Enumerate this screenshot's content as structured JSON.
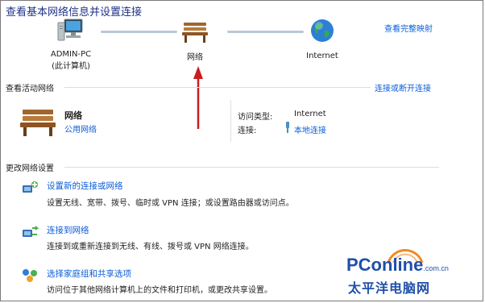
{
  "page": {
    "title": "查看基本网络信息并设置连接",
    "full_map_link": "查看完整映射"
  },
  "map": {
    "computer_name": "ADMIN-PC",
    "computer_sub": "(此计算机)",
    "network_name": "网络",
    "internet_name": "Internet"
  },
  "active": {
    "section_label": "查看活动网络",
    "connect_link": "连接或断开连接",
    "network_name": "网络",
    "network_type": "公用网络",
    "access_type_label": "访问类型:",
    "access_type_value": "Internet",
    "connection_label": "连接:",
    "connection_value": "本地连接"
  },
  "settings": {
    "section_label": "更改网络设置",
    "items": [
      {
        "title": "设置新的连接或网络",
        "desc": "设置无线、宽带、拨号、临时或 VPN 连接；或设置路由器或访问点。"
      },
      {
        "title": "连接到网络",
        "desc": "连接到或重新连接到无线、有线、拨号或 VPN 网络连接。"
      },
      {
        "title": "选择家庭组和共享选项",
        "desc": "访问位于其他网络计算机上的文件和打印机，或更改共享设置。"
      }
    ]
  },
  "watermark": {
    "brand": "PConline",
    "domain": ".com.cn",
    "chinese": "太平洋电脑网"
  },
  "colors": {
    "link": "#0b5ed7",
    "title": "#1e3287",
    "arrow": "#c81e1e"
  }
}
